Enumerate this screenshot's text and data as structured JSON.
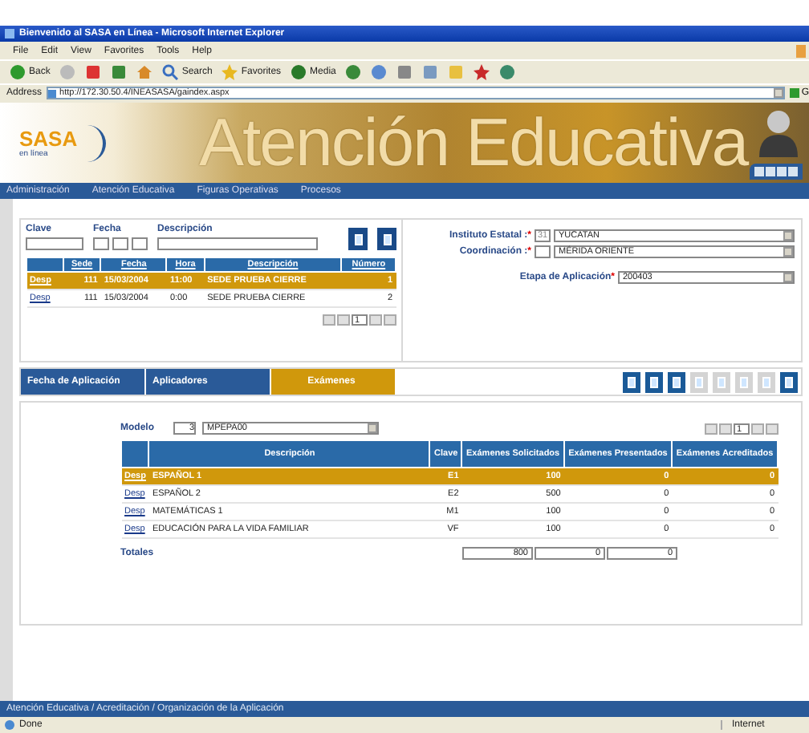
{
  "browser": {
    "title": "Bienvenido al SASA en Línea - Microsoft Internet Explorer",
    "menu": [
      "File",
      "Edit",
      "View",
      "Favorites",
      "Tools",
      "Help"
    ],
    "toolbar": [
      {
        "kind": "back",
        "label": "Back"
      },
      {
        "kind": "forward"
      },
      {
        "kind": "stop"
      },
      {
        "kind": "refresh"
      },
      {
        "kind": "home"
      },
      {
        "kind": "search",
        "label": "Search"
      },
      {
        "kind": "favorites",
        "label": "Favorites"
      },
      {
        "kind": "media",
        "label": "Media"
      },
      {
        "kind": "history"
      },
      {
        "kind": "mail"
      },
      {
        "kind": "print"
      },
      {
        "kind": "edit"
      },
      {
        "kind": "folder"
      },
      {
        "kind": "messenger"
      },
      {
        "kind": "tool"
      }
    ],
    "address_label": "Address",
    "url": "http://172.30.50.4/INEASASA/gaindex.aspx",
    "go": "G",
    "status": "Done",
    "zone": "Internet"
  },
  "app": {
    "logo": "SASA",
    "logo_sub": "en línea",
    "banner_title": "Atención Educativa",
    "nav": [
      "Administración",
      "Atención Educativa",
      "Figuras Operativas",
      "Procesos"
    ],
    "breadcrumb": "Atención Educativa / Acreditación / Organización de la Aplicación"
  },
  "search_fields": [
    {
      "kind": "text",
      "label": "Clave"
    },
    {
      "kind": "date",
      "label": "Fecha"
    },
    {
      "kind": "wide",
      "label": "Descripción"
    }
  ],
  "sedes": {
    "columns": [
      "Sede",
      "Fecha",
      "Hora",
      "Descripción",
      "Número"
    ],
    "rows": [
      {
        "link": "Desp",
        "cells": [
          "111",
          "15/03/2004",
          "11:00",
          "SEDE PRUEBA CIERRE",
          "1"
        ],
        "selected": true
      },
      {
        "link": "Desp",
        "cells": [
          "111",
          "15/03/2004",
          "0:00",
          "SEDE PRUEBA CIERRE",
          "2"
        ],
        "selected": false
      }
    ],
    "page": "1"
  },
  "filters": [
    {
      "label": "Instituto Estatal :",
      "mark": "*",
      "code": "31",
      "value": "YUCATAN"
    },
    {
      "label": "Coordinación :",
      "mark": "*",
      "value": "MÉRIDA ORIENTE"
    },
    {
      "label": "Etapa de Aplicación",
      "mark": "*",
      "value": "200403"
    }
  ],
  "tabs": [
    {
      "label": "Fecha de Aplicación",
      "selected": false
    },
    {
      "label": "Aplicadores",
      "selected": false
    },
    {
      "label": "Exámenes",
      "selected": true
    }
  ],
  "actions": [
    {
      "disabled": false
    },
    {
      "disabled": false
    },
    {
      "disabled": false
    },
    {
      "disabled": true
    },
    {
      "disabled": true
    },
    {
      "disabled": true
    },
    {
      "disabled": true
    },
    {
      "disabled": false
    }
  ],
  "exams": {
    "modelo_label": "Modelo",
    "modelo_code": "3",
    "modelo_value": "MPEPA00",
    "page": "1",
    "columns": [
      "Descripción",
      "Clave",
      "Exámenes Solicitados",
      "Exámenes Presentados",
      "Exámenes Acreditados"
    ],
    "rows": [
      {
        "link": "Desp",
        "cells": [
          "ESPAÑOL 1",
          "E1",
          "100",
          "0",
          "0"
        ],
        "selected": true
      },
      {
        "link": "Desp",
        "cells": [
          "ESPAÑOL 2",
          "E2",
          "500",
          "0",
          "0"
        ],
        "selected": false
      },
      {
        "link": "Desp",
        "cells": [
          "MATEMÁTICAS 1",
          "M1",
          "100",
          "0",
          "0"
        ],
        "selected": false
      },
      {
        "link": "Desp",
        "cells": [
          "EDUCACIÓN PARA LA VIDA FAMILIAR",
          "VF",
          "100",
          "0",
          "0"
        ],
        "selected": false
      }
    ],
    "totals_label": "Totales",
    "totals": [
      "800",
      "0",
      "0"
    ]
  }
}
